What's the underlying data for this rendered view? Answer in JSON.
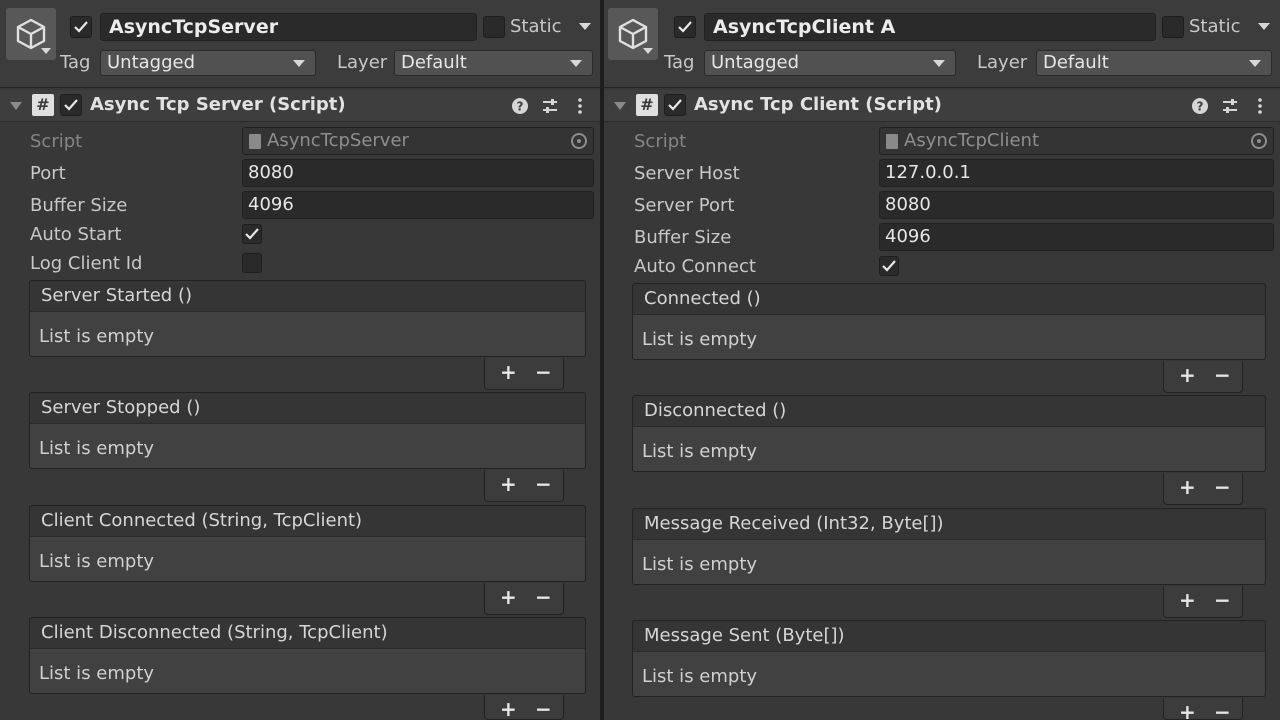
{
  "left": {
    "object": {
      "name": "AsyncTcpServer",
      "active": true,
      "static_label": "Static",
      "tag_label": "Tag",
      "tag_value": "Untagged",
      "layer_label": "Layer",
      "layer_value": "Default"
    },
    "component": {
      "title": "Async Tcp Server (Script)",
      "enabled": true
    },
    "script": {
      "label": "Script",
      "value": "AsyncTcpServer"
    },
    "properties": [
      {
        "label": "Port",
        "value": "8080"
      },
      {
        "label": "Buffer Size",
        "value": "4096"
      }
    ],
    "toggles": [
      {
        "label": "Auto Start",
        "checked": true
      },
      {
        "label": "Log Client Id",
        "checked": false
      }
    ],
    "events": [
      {
        "title": "Server Started ()",
        "body": "List is empty"
      },
      {
        "title": "Server Stopped ()",
        "body": "List is empty"
      },
      {
        "title": "Client Connected (String, TcpClient)",
        "body": "List is empty"
      },
      {
        "title": "Client Disconnected (String, TcpClient)",
        "body": "List is empty"
      }
    ]
  },
  "right": {
    "object": {
      "name": "AsyncTcpClient A",
      "active": true,
      "static_label": "Static",
      "tag_label": "Tag",
      "tag_value": "Untagged",
      "layer_label": "Layer",
      "layer_value": "Default"
    },
    "component": {
      "title": "Async Tcp Client (Script)",
      "enabled": true
    },
    "script": {
      "label": "Script",
      "value": "AsyncTcpClient"
    },
    "properties": [
      {
        "label": "Server Host",
        "value": "127.0.0.1"
      },
      {
        "label": "Server Port",
        "value": "8080"
      },
      {
        "label": "Buffer Size",
        "value": "4096"
      }
    ],
    "toggles": [
      {
        "label": "Auto Connect",
        "checked": true
      }
    ],
    "events": [
      {
        "title": "Connected ()",
        "body": "List is empty"
      },
      {
        "title": "Disconnected ()",
        "body": "List is empty"
      },
      {
        "title": "Message Received (Int32, Byte[])",
        "body": "List is empty"
      },
      {
        "title": "Message Sent (Byte[])",
        "body": "List is empty"
      }
    ]
  },
  "buttons": {
    "plus": "+",
    "minus": "−"
  },
  "icons": {
    "gameobject": "cube-icon",
    "script": "csharp-script-icon",
    "help": "help-icon",
    "presets": "presets-icon",
    "menu": "kebab-menu-icon",
    "object_picker": "object-picker-icon"
  }
}
